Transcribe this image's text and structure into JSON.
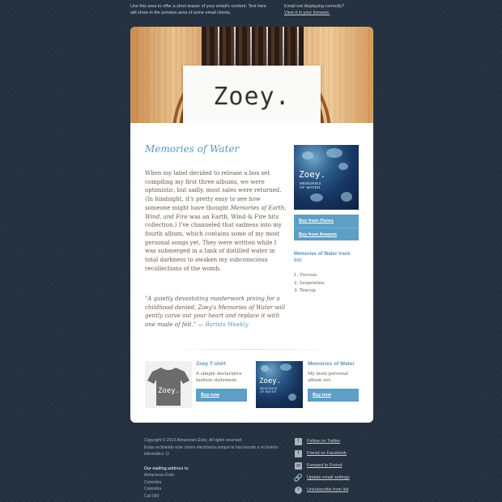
{
  "preheader": {
    "teaser": "Use this area to offer a short teaser of your email's content. Text here will show in the preview area of some email clients.",
    "notice_text": "Email not displaying correctly?",
    "notice_link": "View it in your browser."
  },
  "header": {
    "logo": "Zoey."
  },
  "article": {
    "title": "Memories of Water",
    "body_1": "When my label decided to release a box set compiling my first three albums, we were optimistic, but sadly, most sales were returned. (In hindsight, it's pretty easy to see how someone might have thought ",
    "body_em": "Memories of Earth, Wind, and Fire",
    "body_2": " was an Earth, Wind & Fire hits collection.) I've channeled that sadness into my fourth album, which contains some of my most personal songs yet. They were written while I was submerged in a tank of distilled water in total darkness to awaken my subconscious recollections of the womb.",
    "quote": "\"A quietly devastating masterwork pining for a childhood denied, Zoey's Memories of Water will gently carve out your heart and replace it with one made of felt.\" — ",
    "quote_source": "Barista Weekly"
  },
  "album": {
    "name": "Zoey.",
    "subtitle_line1": "MEMORIES",
    "subtitle_line2": "OF WATER",
    "buy_itunes": "Buy from iTunes",
    "buy_amazon": "Buy from Amazon",
    "tracklist_title": "Memories of Water track list:",
    "tracks": [
      "1. Viscous",
      "2. Serpentine",
      "3. Teacup"
    ]
  },
  "products": [
    {
      "tee_text": "Zoey.",
      "title": "Zoey T-shirt",
      "description": "A simple declarative fashion statement.",
      "button": "Buy now"
    },
    {
      "title": "Memories of Water",
      "description": "My most personal album yet.",
      "button": "Buy now"
    }
  ],
  "footer": {
    "copyright": "Copyright © 2013 Almacenes Éxito, All rights reserved.",
    "reason": "Estas recibiendo este correo electrónico porque te has inscrito a mi boletín informático :D",
    "address_title": "Our mailing address is:",
    "address": [
      "Almacenes Éxito",
      "Colombia",
      "Colombia",
      "Cali 000"
    ],
    "links": [
      "Follow on Twitter",
      "Friend on Facebook",
      "Forward to Friend",
      "Update email settings",
      "Unsubscribe from list"
    ]
  },
  "colors": {
    "accent": "#5d9fc5",
    "background": "#263241",
    "text": "#6a5a4a"
  },
  "icons": [
    "twitter-icon",
    "facebook-icon",
    "email-icon",
    "link-icon",
    "unsubscribe-icon"
  ]
}
